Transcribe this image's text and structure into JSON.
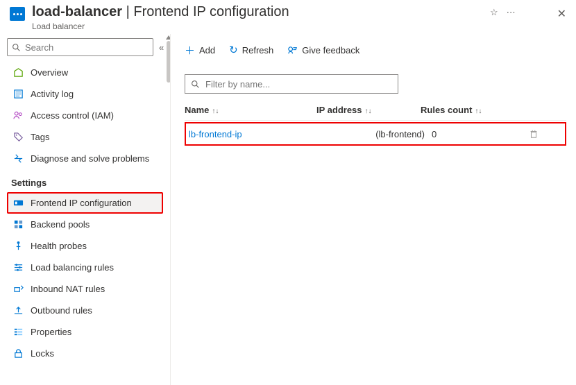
{
  "header": {
    "resource_name": "load-balancer",
    "page_title": "Frontend IP configuration",
    "separator": " | ",
    "subtitle": "Load balancer"
  },
  "sidebar": {
    "search_placeholder": "Search",
    "items_top": [
      {
        "label": "Overview",
        "icon": "overview"
      },
      {
        "label": "Activity log",
        "icon": "activity"
      },
      {
        "label": "Access control (IAM)",
        "icon": "iam"
      },
      {
        "label": "Tags",
        "icon": "tags"
      },
      {
        "label": "Diagnose and solve problems",
        "icon": "diagnose"
      }
    ],
    "section_settings": "Settings",
    "items_settings": [
      {
        "label": "Frontend IP configuration",
        "icon": "frontendip",
        "selected": true,
        "highlighted": true
      },
      {
        "label": "Backend pools",
        "icon": "backend"
      },
      {
        "label": "Health probes",
        "icon": "health"
      },
      {
        "label": "Load balancing rules",
        "icon": "lbrules"
      },
      {
        "label": "Inbound NAT rules",
        "icon": "inbound"
      },
      {
        "label": "Outbound rules",
        "icon": "outbound"
      },
      {
        "label": "Properties",
        "icon": "properties"
      },
      {
        "label": "Locks",
        "icon": "locks"
      }
    ]
  },
  "toolbar": {
    "add": "Add",
    "refresh": "Refresh",
    "feedback": "Give feedback"
  },
  "filter_placeholder": "Filter by name...",
  "table": {
    "headers": {
      "name": "Name",
      "ip": "IP address",
      "rules": "Rules count"
    },
    "rows": [
      {
        "name": "lb-frontend-ip",
        "ip": "(lb-frontend)",
        "rules": "0"
      }
    ]
  }
}
